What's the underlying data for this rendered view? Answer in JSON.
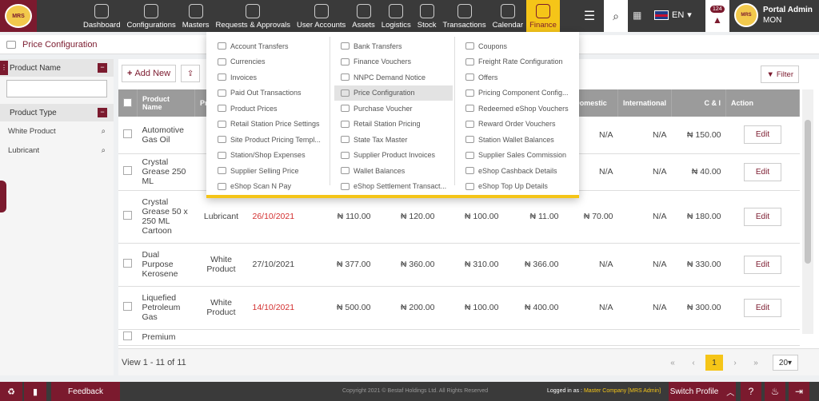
{
  "topbar": {
    "logo": "MRS",
    "nav": [
      {
        "label": "Dashboard",
        "icon": "dashboard-icon"
      },
      {
        "label": "Configurations",
        "icon": "settings-icon"
      },
      {
        "label": "Masters",
        "icon": "masters-icon"
      },
      {
        "label": "Requests & Approvals",
        "icon": "approvals-icon"
      },
      {
        "label": "User Accounts",
        "icon": "users-icon"
      },
      {
        "label": "Assets",
        "icon": "assets-icon"
      },
      {
        "label": "Logistics",
        "icon": "truck-icon"
      },
      {
        "label": "Stock",
        "icon": "stock-icon"
      },
      {
        "label": "Transactions",
        "icon": "transactions-icon"
      },
      {
        "label": "Calendar",
        "icon": "calendar-icon"
      },
      {
        "label": "Finance",
        "icon": "finance-icon"
      }
    ],
    "language": "EN",
    "notification_count": "124",
    "user_name": "Portal Admin",
    "user_sub": "MON"
  },
  "breadcrumb": "Price Configuration",
  "sidebar": {
    "section1": "Product Name",
    "section2": "Product Type",
    "items": [
      "White Product",
      "Lubricant"
    ]
  },
  "toolbar": {
    "add_label": "Add New",
    "filter_label": "Filter"
  },
  "table": {
    "headers": [
      "Product Name",
      "Pr",
      "",
      "",
      "",
      "",
      "",
      "Domestic",
      "International",
      "C & I",
      "Action"
    ],
    "edit_label": "Edit",
    "rows": [
      {
        "name": "Automotive Gas Oil",
        "type": "",
        "date": "",
        "date_red": false,
        "v1": "",
        "v2": "",
        "v3": "",
        "v4": "",
        "domestic": "N/A",
        "international": "N/A",
        "ci": "₦ 150.00"
      },
      {
        "name": "Crystal Grease 250 ML",
        "type": "L",
        "date": "",
        "date_red": false,
        "v1": "",
        "v2": "",
        "v3": "",
        "v4": "",
        "domestic": "N/A",
        "international": "N/A",
        "ci": "₦ 40.00"
      },
      {
        "name": "Crystal Grease 50 x 250 ML Cartoon",
        "type": "Lubricant",
        "date": "26/10/2021",
        "date_red": true,
        "v1": "₦ 110.00",
        "v2": "₦ 120.00",
        "v3": "₦ 100.00",
        "v4": "₦ 11.00",
        "domestic": "₦ 70.00",
        "international": "N/A",
        "ci": "₦ 180.00"
      },
      {
        "name": "Dual Purpose Kerosene",
        "type": "White Product",
        "date": "27/10/2021",
        "date_red": false,
        "v1": "₦ 377.00",
        "v2": "₦ 360.00",
        "v3": "₦ 310.00",
        "v4": "₦ 366.00",
        "domestic": "N/A",
        "international": "N/A",
        "ci": "₦ 330.00"
      },
      {
        "name": "Liquefied Petroleum Gas",
        "type": "White Product",
        "date": "14/10/2021",
        "date_red": true,
        "v1": "₦ 500.00",
        "v2": "₦ 200.00",
        "v3": "₦ 100.00",
        "v4": "₦ 400.00",
        "domestic": "N/A",
        "international": "N/A",
        "ci": "₦ 300.00"
      },
      {
        "name": "Premium",
        "type": "",
        "date": "",
        "date_red": false,
        "v1": "",
        "v2": "",
        "v3": "",
        "v4": "",
        "domestic": "",
        "international": "",
        "ci": ""
      }
    ]
  },
  "pager": {
    "summary": "View 1 - 11 of 11",
    "current": "1",
    "page_size": "20"
  },
  "dropdown": {
    "col1": [
      "Account Transfers",
      "Currencies",
      "Invoices",
      "Paid Out Transactions",
      "Product Prices",
      "Retail Station Price Settings",
      "Site Product Pricing Templ...",
      "Station/Shop Expenses",
      "Supplier Selling Price",
      "eShop Scan N Pay"
    ],
    "col2": [
      "Bank Transfers",
      "Finance Vouchers",
      "NNPC Demand Notice",
      "Price Configuration",
      "Purchase Voucher",
      "Retail Station Pricing",
      "State Tax Master",
      "Supplier Product Invoices",
      "Wallet Balances",
      "eShop Settlement Transact..."
    ],
    "col3": [
      "Coupons",
      "Freight Rate Configuration",
      "Offers",
      "Pricing Component Config...",
      "Redeemed eShop Vouchers",
      "Reward Order Vouchers",
      "Station Wallet Balances",
      "Supplier Sales Commission",
      "eShop Cashback Details",
      "eShop Top Up Details"
    ],
    "highlighted": "Price Configuration"
  },
  "footer": {
    "feedback": "Feedback",
    "copyright": "Copyright 2021 © Bestaf Holdings Ltd. All Rights Reserved",
    "logged_label": "Logged in as :",
    "logged_value": "Master Company [MRS Admin]",
    "switch_profile": "Switch Profile"
  },
  "colors": {
    "brand": "#7b1a2e",
    "accent": "#f5c518"
  }
}
